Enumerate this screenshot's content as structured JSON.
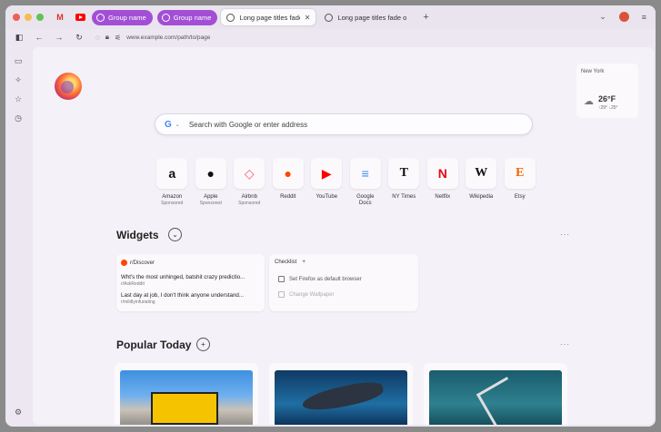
{
  "tabstrip": {
    "pinned": [
      {
        "name": "gmail",
        "glyph": "M"
      },
      {
        "name": "youtube",
        "glyph": ""
      }
    ],
    "groups": [
      "Group name",
      "Group name"
    ],
    "tabs": [
      {
        "title": "Long page titles fade o",
        "active": true
      },
      {
        "title": "Long page titles fade o",
        "active": false
      }
    ],
    "new_tab": "+"
  },
  "toolbar": {
    "url": "www.example.com/path/to/page"
  },
  "weather": {
    "city": "New York",
    "temp": "26°F",
    "hilo": "↑29°  ↓25°"
  },
  "search": {
    "engine": "G",
    "placeholder": "Search with Google or enter address"
  },
  "shortcuts": [
    {
      "label": "Amazon",
      "sub": "Sponsored",
      "glyph": "a",
      "color": "#111111"
    },
    {
      "label": "Apple",
      "sub": "Sponsored",
      "glyph": "",
      "color": "#111111"
    },
    {
      "label": "Airbnb",
      "sub": "Sponsored",
      "glyph": "◇",
      "color": "#ff5a5f"
    },
    {
      "label": "Reddit",
      "sub": "",
      "glyph": "●",
      "color": "#ff4500"
    },
    {
      "label": "YouTube",
      "sub": "",
      "glyph": "▶",
      "color": "#ff0000"
    },
    {
      "label": "Google\nDocs",
      "sub": "",
      "glyph": "≡",
      "color": "#4285f4"
    },
    {
      "label": "NY Times",
      "sub": "",
      "glyph": "T",
      "color": "#111111"
    },
    {
      "label": "Netflix",
      "sub": "",
      "glyph": "N",
      "color": "#e50914"
    },
    {
      "label": "Wikipedia",
      "sub": "",
      "glyph": "W",
      "color": "#111111"
    },
    {
      "label": "Etsy",
      "sub": "",
      "glyph": "E",
      "color": "#f56400"
    }
  ],
  "widgets": {
    "title": "Widgets",
    "reddit": {
      "source": "r/Discover",
      "posts": [
        {
          "title": "Wht's the most unhinged, batshit crazy predictio...",
          "sub": "r/AskReddit"
        },
        {
          "title": "Last day at job, I don't think anyone understand...",
          "sub": "r/mildlyinfuriating"
        }
      ]
    },
    "checklist": {
      "title": "Checklist",
      "add": "+",
      "items": [
        "Set Firefox as default browser",
        "Change Wallpaper"
      ]
    }
  },
  "popular": {
    "title": "Popular Today",
    "add": "+"
  },
  "more": "···"
}
